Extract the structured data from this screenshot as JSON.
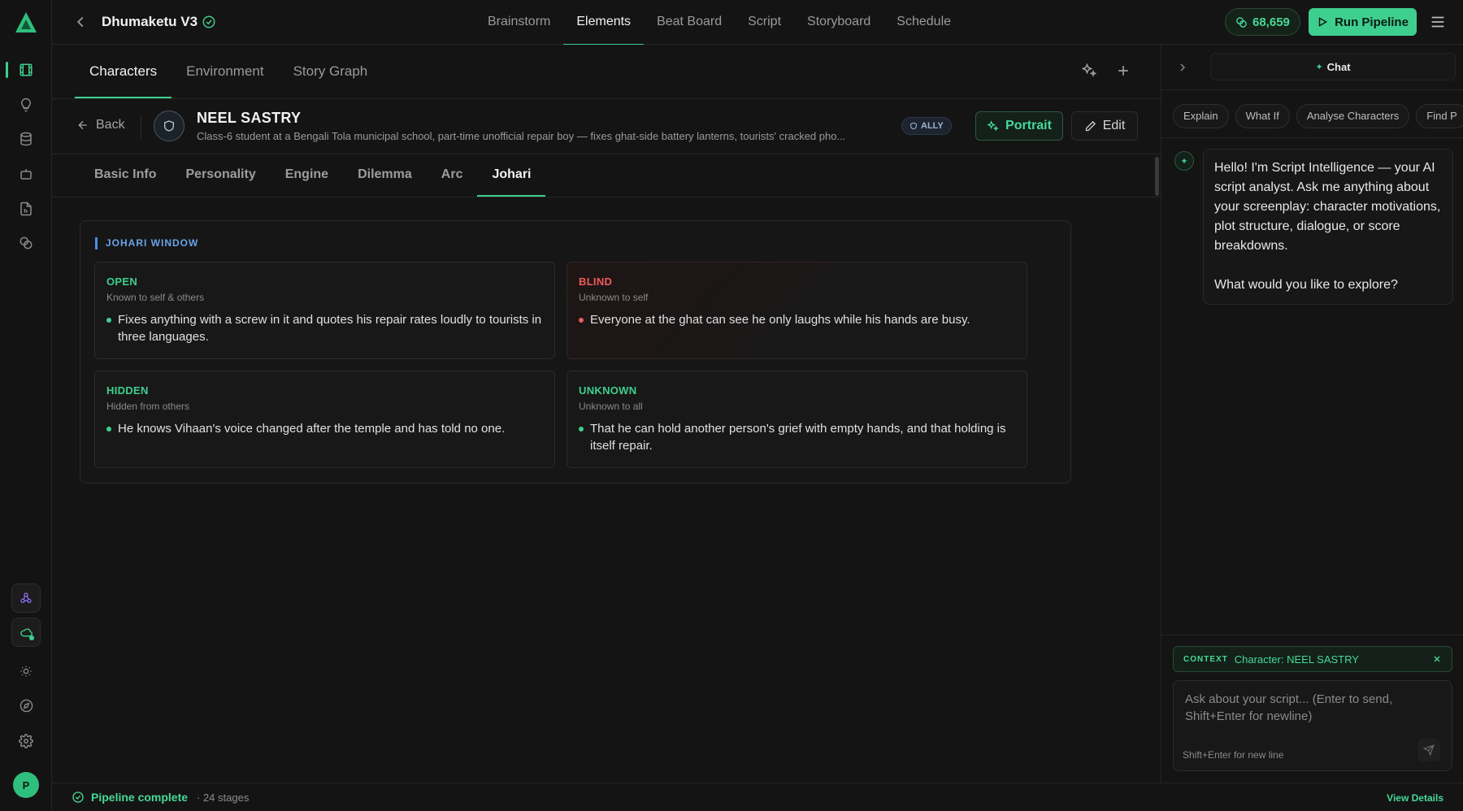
{
  "project": {
    "title": "Dhumaketu V3"
  },
  "nav": {
    "items": [
      {
        "label": "Brainstorm"
      },
      {
        "label": "Elements"
      },
      {
        "label": "Beat Board"
      },
      {
        "label": "Script"
      },
      {
        "label": "Storyboard"
      },
      {
        "label": "Schedule"
      }
    ],
    "active": "Elements"
  },
  "credits": "68,659",
  "run_pipeline_label": "Run Pipeline",
  "subtabs": [
    {
      "label": "Characters"
    },
    {
      "label": "Environment"
    },
    {
      "label": "Story Graph"
    }
  ],
  "character": {
    "back_label": "Back",
    "name": "NEEL SASTRY",
    "description": "Class-6 student at a Bengali Tola municipal school, part-time unofficial repair boy — fixes ghat-side battery lanterns, tourists' cracked pho...",
    "role_badge": "ALLY",
    "portrait_label": "Portrait",
    "edit_label": "Edit"
  },
  "detail_tabs": [
    {
      "label": "Basic Info"
    },
    {
      "label": "Personality"
    },
    {
      "label": "Engine"
    },
    {
      "label": "Dilemma"
    },
    {
      "label": "Arc"
    },
    {
      "label": "Johari"
    }
  ],
  "johari": {
    "title": "JOHARI WINDOW",
    "open": {
      "title": "OPEN",
      "subtitle": "Known to self & others",
      "item": "Fixes anything with a screw in it and quotes his repair rates loudly to tourists in three languages."
    },
    "blind": {
      "title": "BLIND",
      "subtitle": "Unknown to self",
      "item": "Everyone at the ghat can see he only laughs while his hands are busy."
    },
    "hidden": {
      "title": "HIDDEN",
      "subtitle": "Hidden from others",
      "item": "He knows Vihaan's voice changed after the temple and has told no one."
    },
    "unknown": {
      "title": "UNKNOWN",
      "subtitle": "Unknown to all",
      "item": "That he can hold another person's grief with empty hands, and that holding is itself repair."
    }
  },
  "status": {
    "label": "Pipeline complete",
    "stages": "· 24 stages",
    "view_details": "View Details"
  },
  "chat": {
    "tab_label": "Chat",
    "chips": [
      {
        "label": "Explain"
      },
      {
        "label": "What If"
      },
      {
        "label": "Analyse Characters"
      },
      {
        "label": "Find P"
      }
    ],
    "ai_message_1": "Hello! I'm Script Intelligence — your AI script analyst. Ask me anything about your screenplay: character motivations, plot structure, dialogue, or score breakdowns.",
    "ai_message_2": "What would you like to explore?",
    "context_label": "CONTEXT",
    "context_value": "Character: NEEL SASTRY",
    "input_placeholder": "Ask about your script... (Enter to send, Shift+Enter for newline)",
    "hint": "Shift+Enter for new line"
  },
  "colors": {
    "accent": "#3ecf8e",
    "blind_accent": "#ef5b5b",
    "johari_title": "#6aa3ea",
    "background": "#141414"
  }
}
